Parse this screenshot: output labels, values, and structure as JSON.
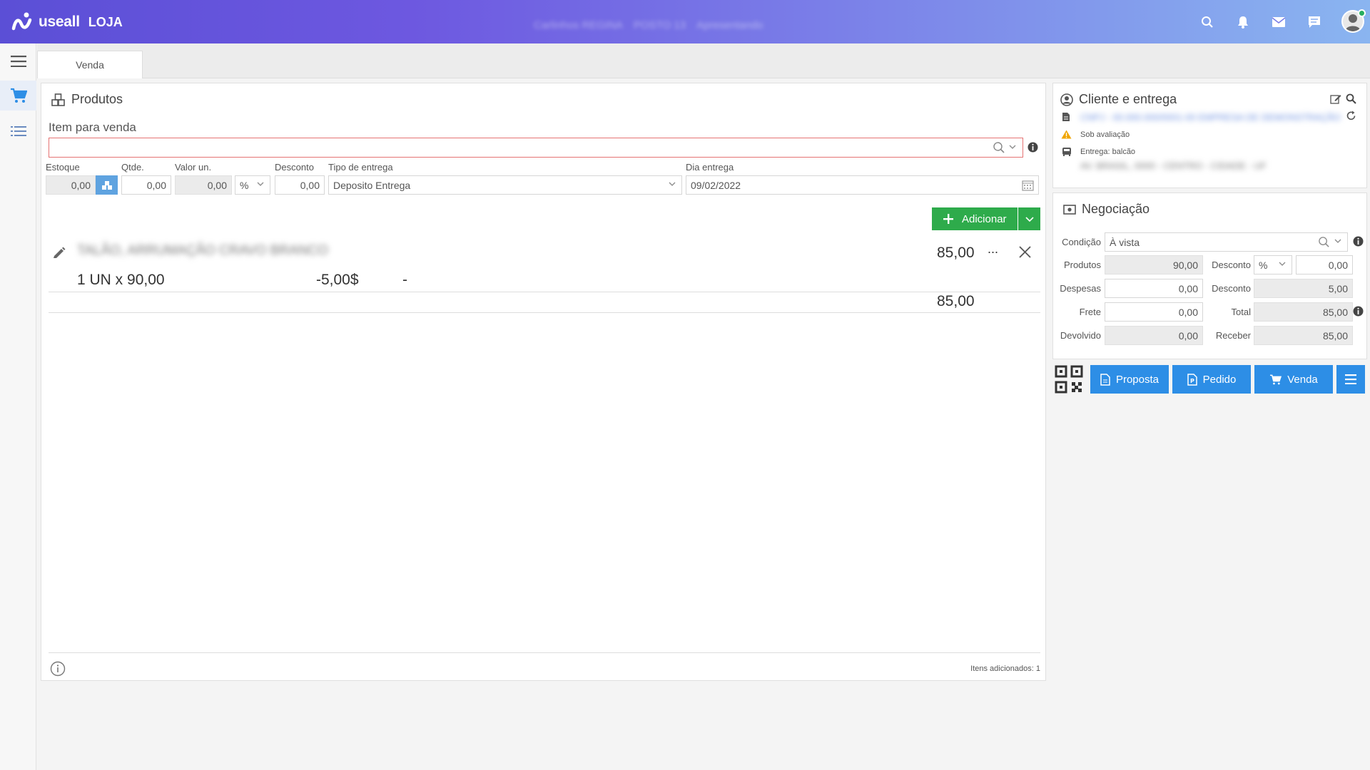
{
  "brand": {
    "logo_text": "useall",
    "module": "LOJA"
  },
  "header": {
    "blurred_items": [
      "Carlinhos REGINA",
      "POSTO 13",
      "Apresentando"
    ]
  },
  "tabs": [
    {
      "label": "Venda"
    }
  ],
  "produtos": {
    "title": "Produtos",
    "item_label": "Item para venda",
    "item_value": "",
    "fields": {
      "estoque": {
        "label": "Estoque",
        "value": "0,00"
      },
      "qtde": {
        "label": "Qtde.",
        "value": "0,00"
      },
      "valor_un": {
        "label": "Valor un.",
        "value": "0,00"
      },
      "desconto_tipo": "%",
      "desconto": {
        "label": "Desconto",
        "value": "0,00"
      },
      "tipo_entrega": {
        "label": "Tipo de entrega",
        "value": "Deposito Entrega"
      },
      "dia_entrega": {
        "label": "Dia entrega",
        "value": "09/02/2022"
      }
    },
    "add_button": "Adicionar",
    "item": {
      "name_blurred": "TALÃO, ARRUMAÇÃO CRAVO BRANCO",
      "price": "85,00",
      "more": "...",
      "qty_line": "1 UN x 90,00",
      "discount": "-5,00$",
      "dash": "-",
      "total": "85,00"
    },
    "footer_count": "Itens adicionados: 1"
  },
  "cliente": {
    "title": "Cliente e entrega",
    "doc_blurred": "CNPJ - 00.000.000/0001-00 EMPRESA DE DEMONSTRAÇÃO",
    "status": "Sob avaliação",
    "entrega": "Entrega: balcão",
    "address_blurred": "AV. BRASIL, 0000 - CENTRO - CIDADE - UF"
  },
  "negociacao": {
    "title": "Negociação",
    "condicao": {
      "label": "Condição",
      "value": "À vista"
    },
    "produtos": {
      "label": "Produtos",
      "value": "90,00"
    },
    "desconto_tipo": {
      "label": "Desconto",
      "value": "%"
    },
    "desconto_valor": "0,00",
    "despesas": {
      "label": "Despesas",
      "value": "0,00"
    },
    "desconto2": {
      "label": "Desconto",
      "value": "5,00"
    },
    "frete": {
      "label": "Frete",
      "value": "0,00"
    },
    "total": {
      "label": "Total",
      "value": "85,00"
    },
    "devolvido": {
      "label": "Devolvido",
      "value": "0,00"
    },
    "receber": {
      "label": "Receber",
      "value": "85,00"
    }
  },
  "actions": {
    "proposta": "Proposta",
    "pedido": "Pedido",
    "venda": "Venda"
  },
  "colors": {
    "accent": "#2d8ee6",
    "green": "#2eab4b",
    "warning": "#f0a500"
  }
}
